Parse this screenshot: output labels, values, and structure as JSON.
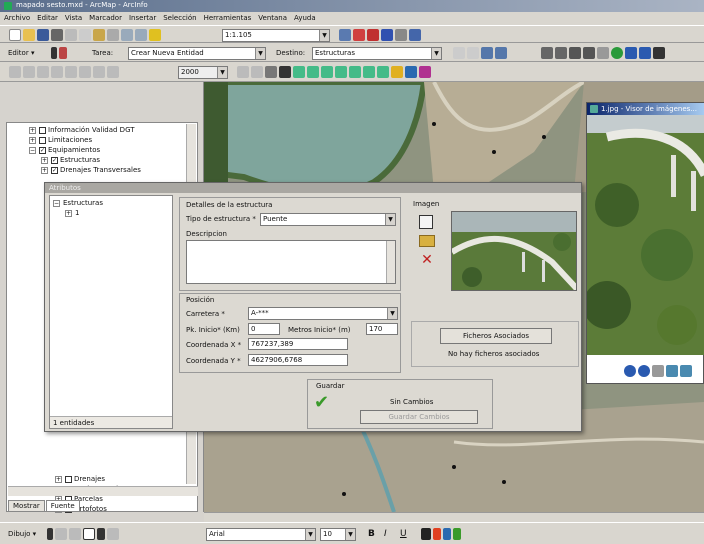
{
  "window": {
    "title": "mapado sesto.mxd - ArcMap - ArcInfo"
  },
  "menu": [
    "Archivo",
    "Editar",
    "Vista",
    "Marcador",
    "Insertar",
    "Selección",
    "Herramientas",
    "Ventana",
    "Ayuda"
  ],
  "toolbar1": {
    "scale": "1:1.105"
  },
  "editor": {
    "editor_label": "Editor ▾",
    "task_label": "Tarea:",
    "task_value": "Crear Nueva Entidad",
    "target_label": "Destino:",
    "target_value": "Estructuras"
  },
  "georef": {
    "zoom_value": "2000"
  },
  "toc": {
    "items": [
      {
        "label": "Información Validad DGT",
        "indent": 0,
        "checked": false,
        "expand": "+"
      },
      {
        "label": "Limitaciones",
        "indent": 0,
        "checked": false,
        "expand": "+"
      },
      {
        "label": "Equipamientos",
        "indent": 0,
        "checked": true,
        "expand": "−"
      },
      {
        "label": "Estructuras",
        "indent": 1,
        "checked": true,
        "expand": "+"
      },
      {
        "label": "Drenajes Transversales",
        "indent": 1,
        "checked": true,
        "expand": "+"
      }
    ],
    "bottom_items": [
      {
        "label": "Drenajes",
        "checked": false
      },
      {
        "label": "Replanteamiento",
        "checked": false
      },
      {
        "label": "Parcelas",
        "checked": false
      },
      {
        "label": "Ortofotos",
        "checked": true
      }
    ],
    "tabs": [
      "Mostrar",
      "Fuente"
    ]
  },
  "attr_window": {
    "title": "Atributos",
    "tree_root": "Estructuras",
    "tree_child": "1",
    "footer": "1 entidades"
  },
  "details": {
    "group_title": "Detalles de la estructura",
    "tipo_label": "Tipo de estructura *",
    "tipo_value": "Puente",
    "descripcion_label": "Descripcion",
    "descripcion_value": ""
  },
  "position": {
    "group_title": "Posición",
    "carretera_label": "Carretera *",
    "carretera_value": "A-***",
    "pk_label": "Pk. Inicio* (Km)",
    "pk_value": "0",
    "metros_label": "Metros Inicio* (m)",
    "metros_value": "170",
    "coordx_label": "Coordenada X *",
    "coordx_value": "767237,389",
    "coordy_label": "Coordenada Y *",
    "coordy_value": "4627906,6768"
  },
  "image": {
    "group_title": "Imagen"
  },
  "files": {
    "button": "Ficheros Asociados",
    "status": "No hay ficheros asociados"
  },
  "save": {
    "group_title": "Guardar",
    "status": "Sin Cambios",
    "button": "Guardar Cambios"
  },
  "viewer": {
    "title": "1.jpg - Visor de imágenes..."
  },
  "draw_toolbar": {
    "draw_label": "Dibujo ▾",
    "font_value": "Arial",
    "size_value": "10",
    "bold": "B",
    "italic": "I",
    "underline": "U"
  },
  "colors": {
    "title_blue": "#0a246a",
    "title_blue2": "#a6caf0",
    "check_green": "#3a9a2a"
  }
}
